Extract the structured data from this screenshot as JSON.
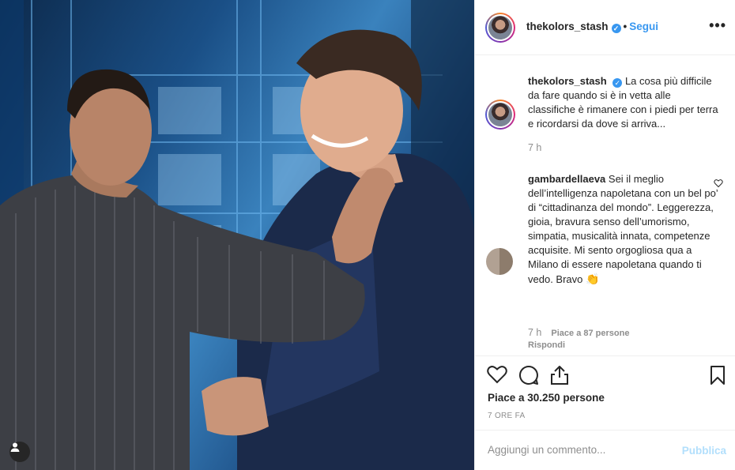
{
  "post": {
    "image_alt": "Two men smiling on a stage; one in a pinstripe suit with his hand on the other's neck",
    "username": "thekolors_stash",
    "follow_label": "Segui",
    "more_icon": "more-horizontal-icon",
    "verified_icon": "verified-badge-icon",
    "caption": {
      "username": "thekolors_stash",
      "text": "La cosa più difficile da fare quando si è in vetta alle classifiche è rimanere con i piedi per terra e ricordarsi da dove si arriva...",
      "time": "7 h"
    },
    "comments": [
      {
        "username": "gambardellaeva",
        "text": "Sei il meglio dell’intelligenza napoletana con un bel po’ di “cittadinanza del mondo”. Leggerezza, gioia, bravura senso dell’umorismo, simpatia, musicalità innata, competenze acquisite. Mi sento orgogliosa qua a Milano di essere napoletana quando ti vedo. Bravo",
        "emoji": "👏",
        "time": "7 h",
        "likes": "Piace a 87 persone",
        "reply_label": "Rispondi"
      }
    ],
    "likes_text": "Piace a 30.250 persone",
    "time_ago": "7 ORE FA",
    "comment_placeholder": "Aggiungi un commento...",
    "publish_label": "Pubblica"
  },
  "colors": {
    "link_blue": "#3897f0",
    "publish_disabled": "#b2dffc",
    "muted_gray": "#8e8e8e",
    "text": "#262626"
  }
}
